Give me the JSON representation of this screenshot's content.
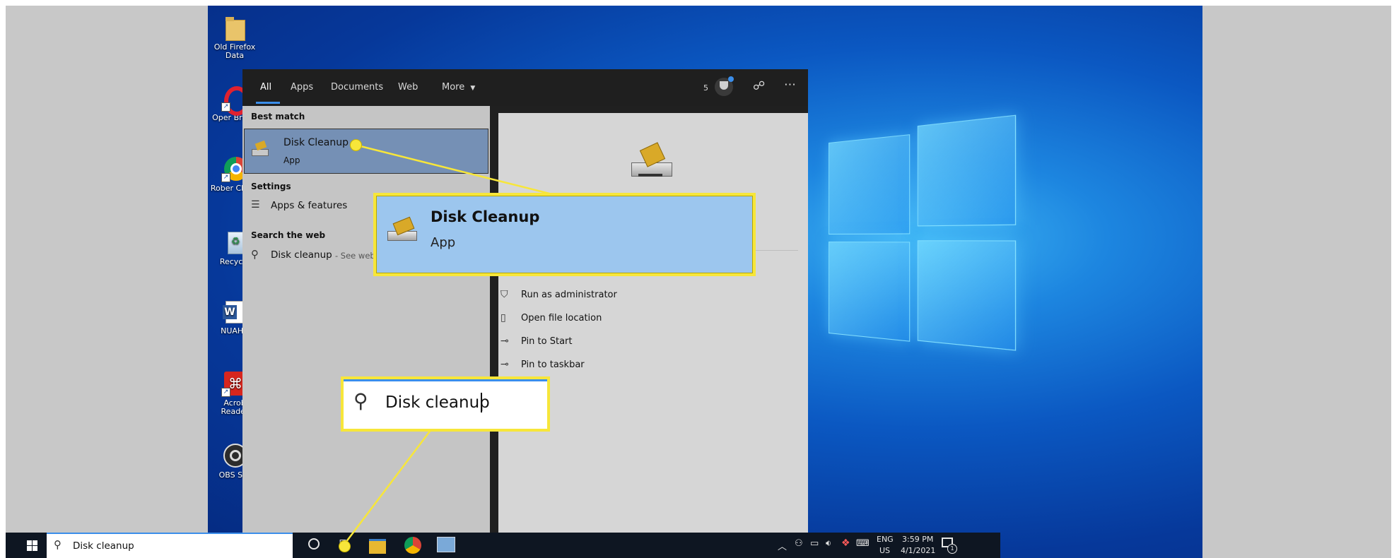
{
  "desktop_icons": [
    {
      "label": "Old Firefox Data",
      "icon": "folder-icon"
    },
    {
      "label": "Oper Brows",
      "icon": "opera-icon"
    },
    {
      "label": "Rober Chron",
      "icon": "chrome-icon"
    },
    {
      "label": "Recycle",
      "icon": "recycle-bin-icon"
    },
    {
      "label": "NUAHR",
      "icon": "word-icon"
    },
    {
      "label": "Acrob Reader",
      "icon": "acrobat-icon"
    },
    {
      "label": "OBS Stu",
      "icon": "obs-icon"
    }
  ],
  "search_menu": {
    "tabs": [
      "All",
      "Apps",
      "Documents",
      "Web",
      "More"
    ],
    "active_tab": "All",
    "header_right": {
      "points": "5"
    },
    "best_match": {
      "section": "Best match",
      "title": "Disk Cleanup",
      "subtitle": "App"
    },
    "settings": {
      "section": "Settings",
      "item": "Apps & features"
    },
    "web": {
      "section": "Search the web",
      "query": "Disk cleanup",
      "suffix": " - See web"
    },
    "actions": [
      {
        "label": "Run as administrator",
        "icon": "admin-shield-icon"
      },
      {
        "label": "Open file location",
        "icon": "folder-location-icon"
      },
      {
        "label": "Pin to Start",
        "icon": "pin-icon"
      },
      {
        "label": "Pin to taskbar",
        "icon": "pin-icon"
      }
    ]
  },
  "callouts": {
    "app_title": "Disk Cleanup",
    "app_subtitle": "App",
    "search_text": "Disk cleanup"
  },
  "taskbar": {
    "search_text": "Disk cleanup",
    "lang_top": "ENG",
    "lang_bottom": "US",
    "time": "3:59 PM",
    "date": "4/1/2021",
    "notification_count": "1"
  },
  "colors": {
    "highlight": "#f7e63a",
    "selected_row": "#7590b5",
    "callout_fill": "#9cc6ee"
  }
}
